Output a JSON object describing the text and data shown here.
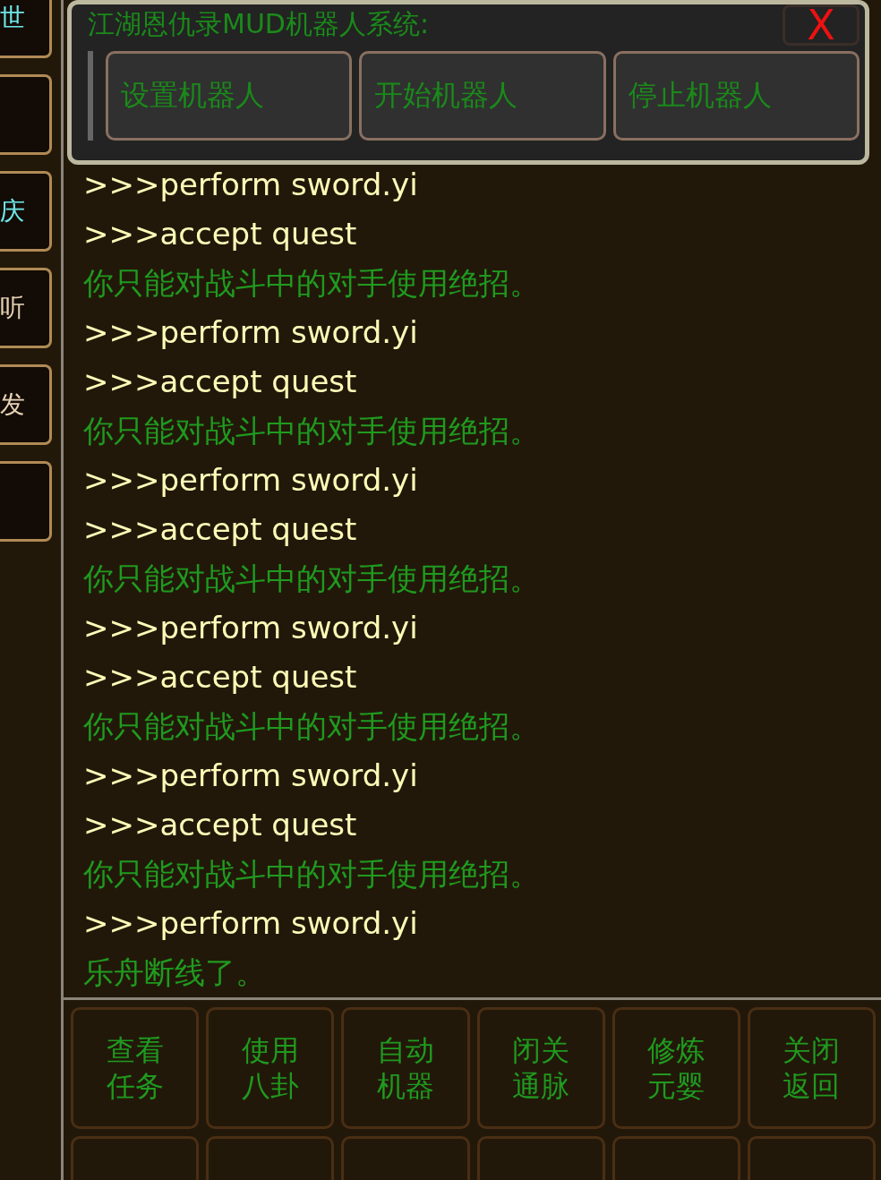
{
  "sidebar": {
    "items": [
      {
        "kind": "button",
        "label": "世",
        "color": "#6fe6e6"
      },
      {
        "kind": "button"
      },
      {
        "kind": "button",
        "label": "庆",
        "color": "#6fe6e6"
      },
      {
        "kind": "button",
        "label": "听",
        "color": "#e6d2b4"
      },
      {
        "kind": "button",
        "label": "发",
        "color": "#e6d2b4"
      },
      {
        "kind": "button"
      }
    ]
  },
  "dialog": {
    "title": "江湖恩仇录MUD机器人系统:",
    "close": "X",
    "buttons": [
      "设置机器人",
      "开始机器人",
      "停止机器人"
    ]
  },
  "log": [
    {
      "kind": "command",
      "text": ">>>perform sword.yi"
    },
    {
      "kind": "command",
      "text": ">>>accept quest"
    },
    {
      "kind": "message",
      "text": "你只能对战斗中的对手使用绝招。"
    },
    {
      "kind": "command",
      "text": ">>>perform sword.yi"
    },
    {
      "kind": "command",
      "text": ">>>accept quest"
    },
    {
      "kind": "message",
      "text": "你只能对战斗中的对手使用绝招。"
    },
    {
      "kind": "command",
      "text": ">>>perform sword.yi"
    },
    {
      "kind": "command",
      "text": ">>>accept quest"
    },
    {
      "kind": "message",
      "text": "你只能对战斗中的对手使用绝招。"
    },
    {
      "kind": "command",
      "text": ">>>perform sword.yi"
    },
    {
      "kind": "command",
      "text": ">>>accept quest"
    },
    {
      "kind": "message",
      "text": "你只能对战斗中的对手使用绝招。"
    },
    {
      "kind": "command",
      "text": ">>>perform sword.yi"
    },
    {
      "kind": "command",
      "text": ">>>accept quest"
    },
    {
      "kind": "message",
      "text": "你只能对战斗中的对手使用绝招。"
    },
    {
      "kind": "command",
      "text": ">>>perform sword.yi"
    },
    {
      "kind": "message",
      "text": "乐舟断线了。"
    }
  ],
  "actions": [
    {
      "lines": [
        "查看",
        "任务"
      ]
    },
    {
      "lines": [
        "使用",
        "八卦"
      ]
    },
    {
      "lines": [
        "自动",
        "机器"
      ]
    },
    {
      "lines": [
        "闭关",
        "通脉"
      ]
    },
    {
      "lines": [
        "修炼",
        "元婴"
      ]
    },
    {
      "lines": [
        "关闭",
        "返回"
      ]
    }
  ]
}
